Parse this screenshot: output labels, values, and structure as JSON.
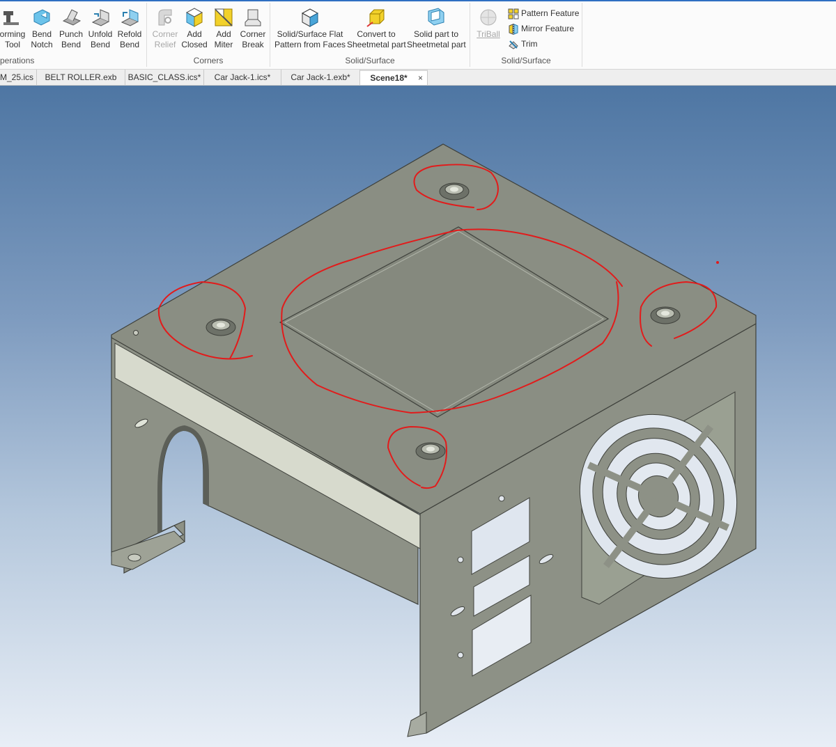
{
  "ribbon": {
    "groups": [
      {
        "label": "perations",
        "buttons": [
          {
            "line1": "orming",
            "line2": "Tool",
            "icon": "forming-tool-icon"
          },
          {
            "line1": "Bend",
            "line2": "Notch",
            "icon": "bend-notch-icon"
          },
          {
            "line1": "Punch",
            "line2": "Bend",
            "icon": "punch-bend-icon"
          },
          {
            "line1": "Unfold",
            "line2": "Bend",
            "icon": "unfold-bend-icon"
          },
          {
            "line1": "Refold",
            "line2": "Bend",
            "icon": "refold-bend-icon"
          }
        ]
      },
      {
        "label": "Corners",
        "buttons": [
          {
            "line1": "Corner",
            "line2": "Relief",
            "icon": "corner-relief-icon",
            "disabled": true
          },
          {
            "line1": "Add",
            "line2": "Closed",
            "icon": "add-closed-icon"
          },
          {
            "line1": "Add",
            "line2": "Miter",
            "icon": "add-miter-icon"
          },
          {
            "line1": "Corner",
            "line2": "Break",
            "icon": "corner-break-icon"
          }
        ]
      },
      {
        "label": "Solid/Surface",
        "buttons": [
          {
            "line1": "Solid/Surface Flat",
            "line2": "Pattern from Faces",
            "icon": "flat-pattern-icon"
          },
          {
            "line1": "Convert to",
            "line2": "Sheetmetal part",
            "icon": "convert-sheetmetal-icon"
          },
          {
            "line1": "Solid part to",
            "line2": "Sheetmetal part",
            "icon": "solid-to-sheetmetal-icon"
          }
        ]
      },
      {
        "label": "Solid/Surface",
        "buttons": [
          {
            "line1": "TriBall",
            "line2": "",
            "icon": "triball-icon",
            "disabled": true
          }
        ],
        "small": [
          {
            "label": "Pattern Feature",
            "icon": "pattern-feature-icon"
          },
          {
            "label": "Mirror Feature",
            "icon": "mirror-feature-icon"
          },
          {
            "label": "Trim",
            "icon": "trim-icon"
          }
        ]
      }
    ]
  },
  "tabs": [
    {
      "label": "M_25.ics"
    },
    {
      "label": "BELT ROLLER.exb"
    },
    {
      "label": "BASIC_CLASS.ics*"
    },
    {
      "label": "Car Jack-1.ics*"
    },
    {
      "label": "Car Jack-1.exb*"
    },
    {
      "label": "Scene18*",
      "active": true,
      "close": "×"
    }
  ],
  "viewport": {
    "background_top": "#4e76a3",
    "background_bottom": "#e8eef6",
    "part_color": "#8d9186",
    "annotation_color": "#e21b1b"
  }
}
